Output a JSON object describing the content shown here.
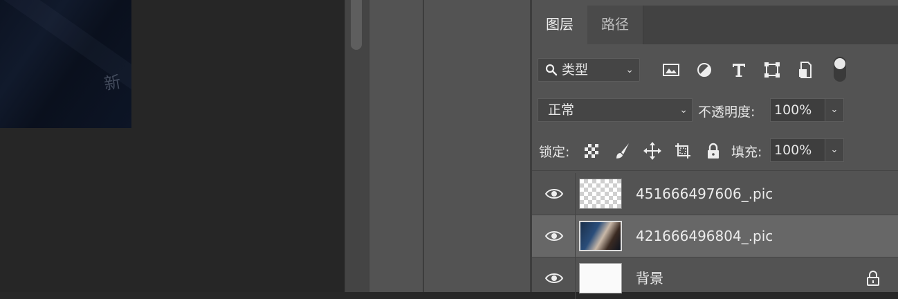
{
  "canvas": {
    "watermark_text": "新"
  },
  "panel": {
    "tabs": [
      {
        "label": "图层"
      },
      {
        "label": "路径"
      }
    ],
    "filter": {
      "kind_label": "类型",
      "icons": [
        "image-filter-icon",
        "adjustment-filter-icon",
        "type-filter-icon",
        "shape-filter-icon",
        "smart-object-filter-icon"
      ],
      "toggle_on": true
    },
    "blend": {
      "mode": "正常",
      "opacity_label": "不透明度:",
      "opacity_value": "100%"
    },
    "lock": {
      "label": "锁定:",
      "icons": [
        "lock-transparent-pixels-icon",
        "lock-image-pixels-icon",
        "lock-position-icon",
        "lock-artboard-icon",
        "lock-all-icon"
      ],
      "fill_label": "填充:",
      "fill_value": "100%"
    },
    "layers": [
      {
        "name": "451666497606_.pic",
        "visible": true,
        "selected": false,
        "thumb": "transparent"
      },
      {
        "name": "421666496804_.pic",
        "visible": true,
        "selected": true,
        "thumb": "photo"
      },
      {
        "name": "背景",
        "visible": true,
        "selected": false,
        "thumb": "white",
        "locked": true
      }
    ]
  },
  "colors": {
    "panel_bg": "#535353",
    "selected_row": "#676767",
    "canvas_bg": "#262626"
  }
}
